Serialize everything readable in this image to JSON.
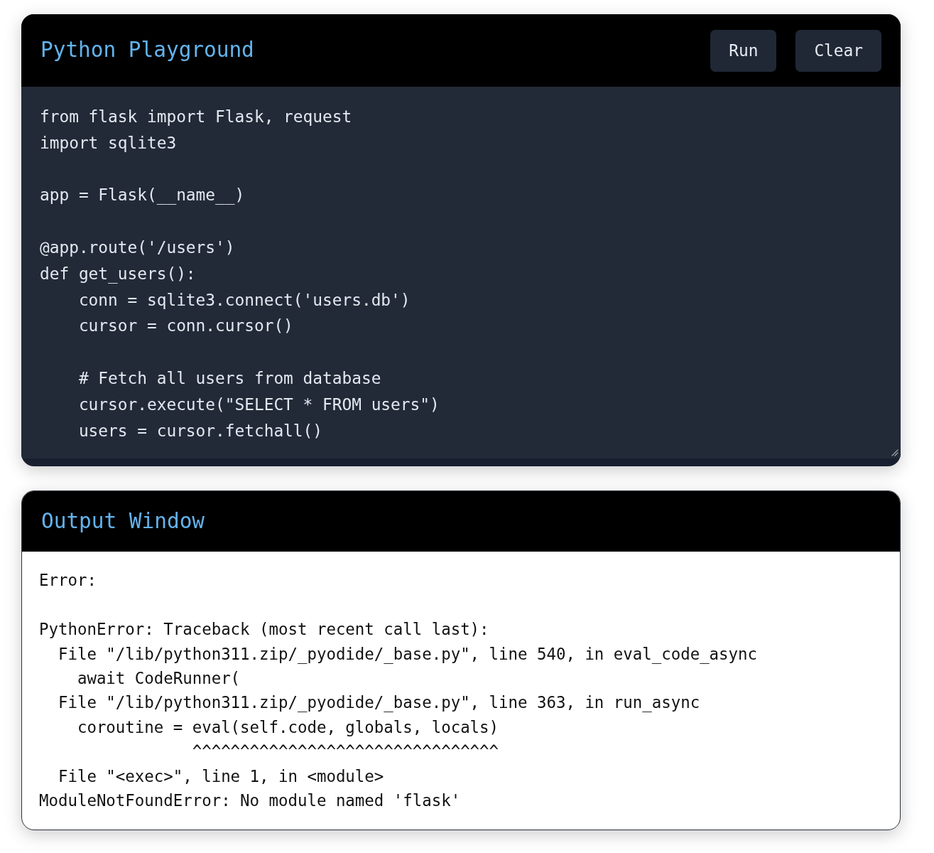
{
  "playground": {
    "title": "Python Playground",
    "buttons": [
      "Run",
      "Clear"
    ],
    "code": "from flask import Flask, request\nimport sqlite3\n\napp = Flask(__name__)\n\n@app.route('/users')\ndef get_users():\n    conn = sqlite3.connect('users.db')\n    cursor = conn.cursor()\n\n    # Fetch all users from database\n    cursor.execute(\"SELECT * FROM users\")\n    users = cursor.fetchall()"
  },
  "output": {
    "title": "Output Window",
    "text": "Error:\n\nPythonError: Traceback (most recent call last):\n  File \"/lib/python311.zip/_pyodide/_base.py\", line 540, in eval_code_async\n    await CodeRunner(\n  File \"/lib/python311.zip/_pyodide/_base.py\", line 363, in run_async\n    coroutine = eval(self.code, globals, locals)\n                ^^^^^^^^^^^^^^^^^^^^^^^^^^^^^^^^\n  File \"<exec>\", line 1, in <module>\nModuleNotFoundError: No module named 'flask'"
  }
}
